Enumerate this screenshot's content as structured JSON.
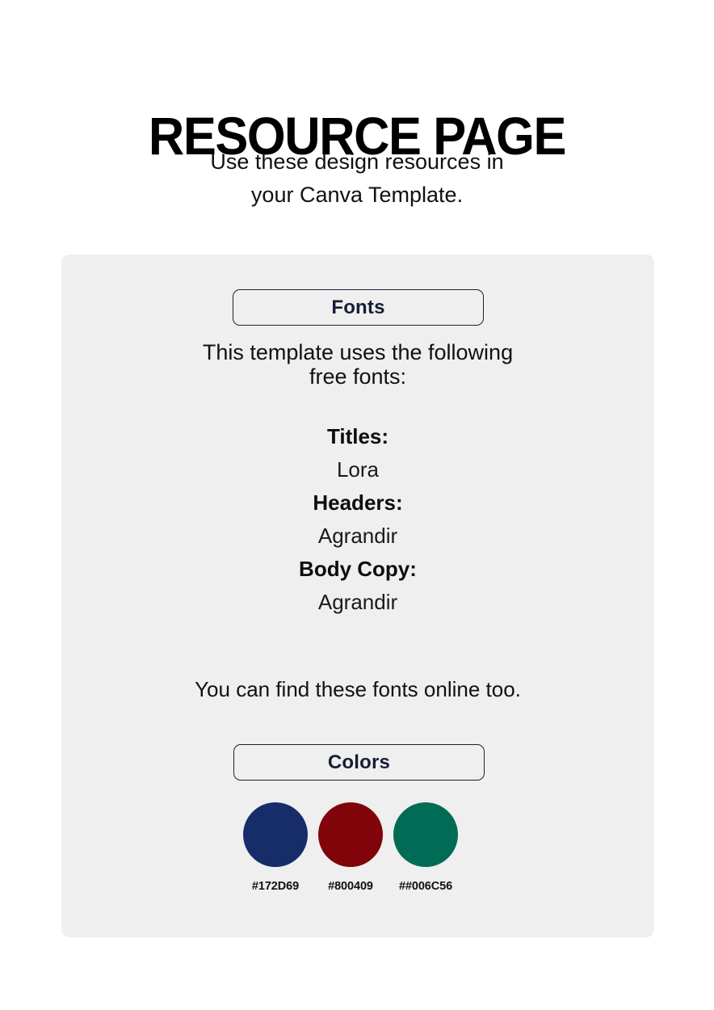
{
  "header": {
    "title": "RESOURCE PAGE",
    "subtitle_line1": "Use these design resources in",
    "subtitle_line2": "your Canva Template."
  },
  "card": {
    "background_color": "#EFEFEF",
    "fonts_section": {
      "badge_label": "Fonts",
      "intro_line1": "This template uses the following",
      "intro_line2": "free fonts:",
      "entries": [
        {
          "role": "Titles:",
          "font": "Lora"
        },
        {
          "role": "Headers:",
          "font": "Agrandir"
        },
        {
          "role": "Body Copy:",
          "font": "Agrandir"
        }
      ],
      "outro": "You can find these fonts online too."
    },
    "colors_section": {
      "badge_label": "Colors",
      "swatches": [
        {
          "label": "#172D69",
          "color": "#172D69"
        },
        {
          "label": "#800409",
          "color": "#800409"
        },
        {
          "label": "##006C56",
          "color": "#006C56"
        }
      ]
    }
  }
}
